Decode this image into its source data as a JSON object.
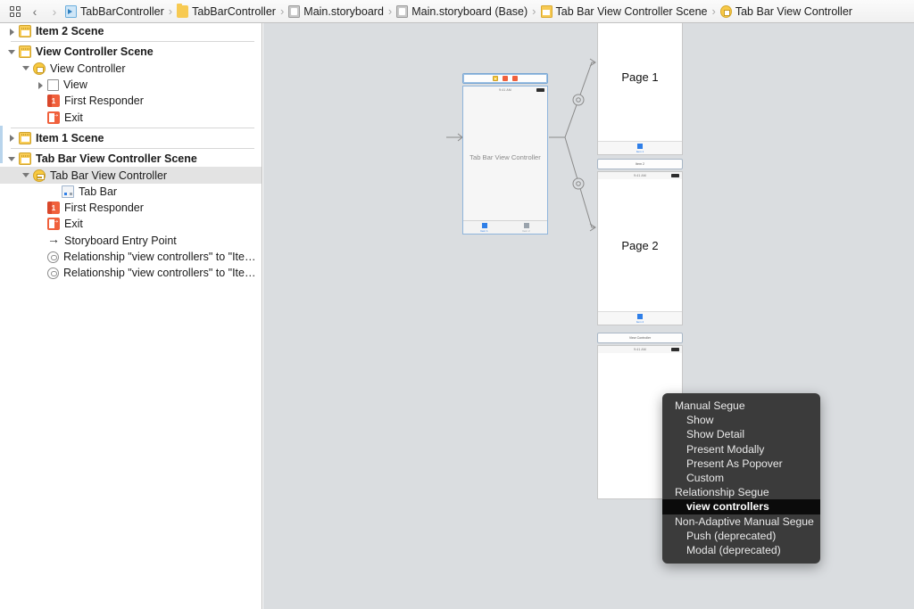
{
  "jumpbar": {
    "nav": {
      "back": "‹",
      "forward": "›",
      "grid_icon": "grid-icon"
    },
    "crumbs": [
      {
        "label": "TabBarController",
        "icon": "project-icon"
      },
      {
        "label": "TabBarController",
        "icon": "folder-icon"
      },
      {
        "label": "Main.storyboard",
        "icon": "storyboard-icon"
      },
      {
        "label": "Main.storyboard (Base)",
        "icon": "storyboard-icon"
      },
      {
        "label": "Tab Bar View Controller Scene",
        "icon": "scene-icon"
      },
      {
        "label": "Tab Bar View Controller",
        "icon": "view-controller-icon"
      }
    ],
    "separator": "›"
  },
  "outline": {
    "rows": [
      {
        "label": "Item 2 Scene",
        "indent": 0,
        "twist": "right",
        "icon": "scene-icon",
        "bold": true,
        "selected": false
      },
      {
        "label": "View Controller Scene",
        "indent": 0,
        "twist": "down",
        "icon": "scene-icon",
        "bold": true,
        "selected": false
      },
      {
        "label": "View Controller",
        "indent": 1,
        "twist": "down",
        "icon": "view-controller-icon",
        "bold": false,
        "selected": false
      },
      {
        "label": "View",
        "indent": 2,
        "twist": "right",
        "icon": "view-icon",
        "bold": false,
        "selected": false
      },
      {
        "label": "First Responder",
        "indent": 2,
        "twist": "none",
        "icon": "first-responder-icon",
        "bold": false,
        "selected": false
      },
      {
        "label": "Exit",
        "indent": 2,
        "twist": "none",
        "icon": "exit-icon",
        "bold": false,
        "selected": false
      },
      {
        "label": "Item 1 Scene",
        "indent": 0,
        "twist": "right",
        "icon": "scene-icon",
        "bold": true,
        "selected": false
      },
      {
        "label": "Tab Bar View Controller Scene",
        "indent": 0,
        "twist": "down",
        "icon": "scene-icon",
        "bold": true,
        "selected": false
      },
      {
        "label": "Tab Bar View Controller",
        "indent": 1,
        "twist": "down",
        "icon": "tab-bar-controller-icon",
        "bold": false,
        "selected": true
      },
      {
        "label": "Tab Bar",
        "indent": 3,
        "twist": "none",
        "icon": "tab-bar-icon",
        "bold": false,
        "selected": false
      },
      {
        "label": "First Responder",
        "indent": 2,
        "twist": "none",
        "icon": "first-responder-icon",
        "bold": false,
        "selected": false
      },
      {
        "label": "Exit",
        "indent": 2,
        "twist": "none",
        "icon": "exit-icon",
        "bold": false,
        "selected": false
      },
      {
        "label": "Storyboard Entry Point",
        "indent": 2,
        "twist": "none",
        "icon": "entry-point-icon",
        "bold": false,
        "selected": false
      },
      {
        "label": "Relationship \"view controllers\" to \"Ite…",
        "indent": 2,
        "twist": "none",
        "icon": "relationship-icon",
        "bold": false,
        "selected": false
      },
      {
        "label": "Relationship \"view controllers\" to \"Ite…",
        "indent": 2,
        "twist": "none",
        "icon": "relationship-icon",
        "bold": false,
        "selected": false
      }
    ],
    "dividers_after": [
      0,
      5,
      6
    ]
  },
  "canvas": {
    "tab_bar_scene": {
      "center_label": "Tab Bar View Controller",
      "status_time": "9:41 AM",
      "dock_icons": [
        "view-controller-icon",
        "first-responder-icon",
        "exit-icon"
      ],
      "tabs": [
        {
          "title": "Item 1",
          "selected": true
        },
        {
          "title": "Item 2",
          "selected": false
        }
      ]
    },
    "page_scenes": [
      {
        "title": "Page 1",
        "dock_label": "",
        "status_time": "",
        "tab_title": "Item 1"
      },
      {
        "title": "Page 2",
        "dock_label": "Item 2",
        "status_time": "9:41 AM",
        "tab_title": "Item 2"
      },
      {
        "title": "",
        "dock_label": "View Controller",
        "status_time": "9:41 AM",
        "tab_title": ""
      }
    ]
  },
  "context_menu": {
    "items": [
      {
        "label": "Manual Segue",
        "group": true,
        "highlighted": false
      },
      {
        "label": "Show",
        "group": false,
        "highlighted": false
      },
      {
        "label": "Show Detail",
        "group": false,
        "highlighted": false
      },
      {
        "label": "Present Modally",
        "group": false,
        "highlighted": false
      },
      {
        "label": "Present As Popover",
        "group": false,
        "highlighted": false
      },
      {
        "label": "Custom",
        "group": false,
        "highlighted": false
      },
      {
        "label": "Relationship Segue",
        "group": true,
        "highlighted": false
      },
      {
        "label": "view controllers",
        "group": false,
        "highlighted": true
      },
      {
        "label": "Non-Adaptive Manual Segue",
        "group": true,
        "highlighted": false
      },
      {
        "label": "Push (deprecated)",
        "group": false,
        "highlighted": false
      },
      {
        "label": "Modal (deprecated)",
        "group": false,
        "highlighted": false
      }
    ]
  },
  "colors": {
    "canvas_bg": "#dadde0",
    "menu_bg": "#3b3b3b",
    "menu_highlight": "#0b0b0b",
    "accent_blue": "#2f7fe8",
    "scene_yellow": "#f8cc55",
    "exit_red": "#f0603c"
  }
}
